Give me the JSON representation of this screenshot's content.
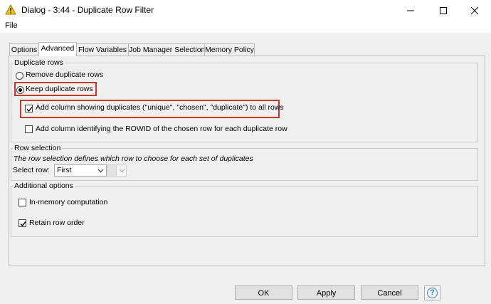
{
  "window": {
    "title": "Dialog - 3:44 - Duplicate Row Filter"
  },
  "menu": {
    "file": "File"
  },
  "tabs": [
    "Options",
    "Advanced",
    "Flow Variables",
    "Job Manager Selection",
    "Memory Policy"
  ],
  "active_tab": "Advanced",
  "duplicate_rows": {
    "title": "Duplicate rows",
    "remove_label": "Remove duplicate rows",
    "keep_label": "Keep duplicate rows",
    "selected": "keep",
    "add_column_label": "Add column showing duplicates (\"unique\", \"chosen\", \"duplicate\") to all rows",
    "add_column_checked": true,
    "add_rowid_label": "Add column identifying the ROWID of the chosen row for each duplicate row",
    "add_rowid_checked": false
  },
  "row_selection": {
    "title": "Row selection",
    "description": "The row selection defines which row to choose for each set of duplicates",
    "select_row_label": "Select row:",
    "select_row_value": "First"
  },
  "additional_options": {
    "title": "Additional options",
    "in_memory_label": "In-memory computation",
    "in_memory_checked": false,
    "retain_order_label": "Retain row order",
    "retain_order_checked": true
  },
  "buttons": {
    "ok": "OK",
    "apply": "Apply",
    "cancel": "Cancel",
    "help": "?"
  },
  "colors": {
    "highlight": "#c0392b",
    "accent": "#f2c40f",
    "help": "#2a7fd4"
  }
}
